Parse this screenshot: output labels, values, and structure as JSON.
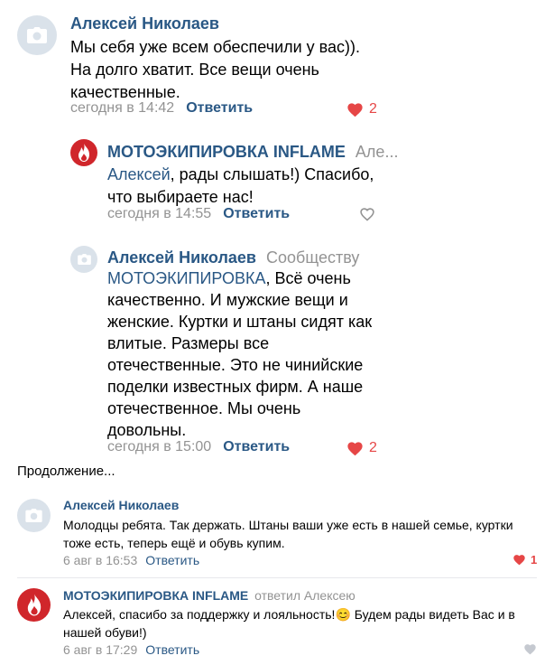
{
  "comments": [
    {
      "author": "Алексей Николаев",
      "text": "Мы себя уже всем обеспечили у вас)). На долго хватит. Все вещи очень качественные.",
      "time": "сегодня в 14:42",
      "reply_label": "Ответить",
      "likes": "2",
      "liked": true
    },
    {
      "author": "МОТОЭКИПИРОВКА INFLAME",
      "addressee": "Але...",
      "mention": "Алексей",
      "text": ", рады слышать!) Спасибо, что выбираете нас!",
      "time": "сегодня в 14:55",
      "reply_label": "Ответить",
      "likes": "",
      "liked": false
    },
    {
      "author": "Алексей Николаев",
      "addressee": "Сообществу",
      "mention": "МОТОЭКИПИРОВКА",
      "text": ", Всё очень качественно. И мужские вещи и женские. Куртки и штаны сидят как влитые. Размеры все отечественные. Это не чинийские поделки известных фирм. А наше отечественное. Мы очень довольны.",
      "time": "сегодня в 15:00",
      "reply_label": "Ответить",
      "likes": "2",
      "liked": true
    }
  ],
  "continuation_label": "Продолжение...",
  "comments2": [
    {
      "author": "Алексей Николаев",
      "text": "Молодцы ребята. Так держать. Штаны ваши уже есть в нашей семье, куртки тоже есть, теперь ещё и обувь купим.",
      "time": "6 авг в 16:53",
      "reply_label": "Ответить",
      "likes": "1",
      "liked": true
    },
    {
      "author": "МОТОЭКИПИРОВКА INFLAME",
      "addressee": "ответил Алексею",
      "text_before_emoji": "Алексей, спасибо за поддержку и лояльность!",
      "emoji": "😊",
      "text_after_emoji": " Будем рады видеть Вас и в нашей обуви!)",
      "time": "6 авг в 17:29",
      "reply_label": "Ответить",
      "likes": "",
      "liked": false
    }
  ],
  "colors": {
    "link": "#2a5885",
    "muted": "#939393",
    "like": "#e64646",
    "avatar_bg": "#dae2ea",
    "brand_red": "#d0262b"
  },
  "icons": {
    "avatar_placeholder": "camera-icon",
    "brand_avatar": "flame-logo-icon",
    "like": "heart-icon"
  }
}
